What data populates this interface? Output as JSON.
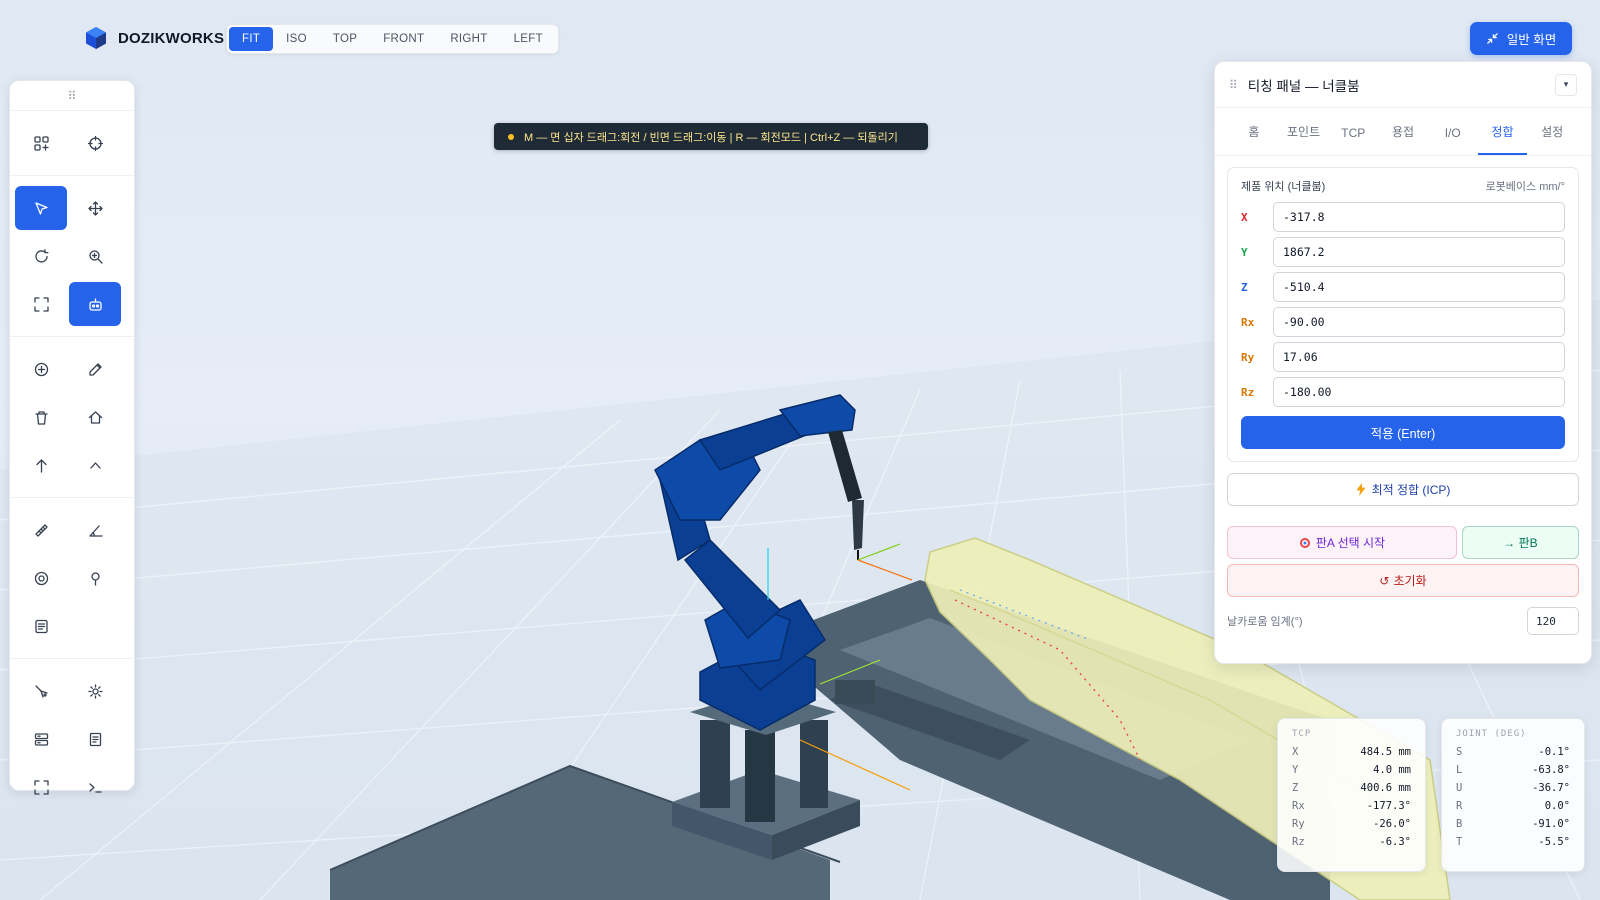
{
  "app": {
    "brand": "DOZIKWORKS"
  },
  "view_tabs": [
    "FIT",
    "ISO",
    "TOP",
    "FRONT",
    "RIGHT",
    "LEFT"
  ],
  "active_view": "FIT",
  "normal_view_label": "일반 화면",
  "hint": "M — 면 십자 드래그:회전 / 빈면 드래그:이동 | R — 회전모드 | Ctrl+Z — 되돌리기",
  "toolbar": {
    "groups": [
      [
        "grid-add-icon",
        "crosshair-icon"
      ],
      [
        "cursor-icon",
        "move-icon",
        "rotate-icon",
        "zoom-icon",
        "fullscreen-icon",
        "robot-icon"
      ],
      [
        "add-circle-icon",
        "edit-icon",
        "trash-icon",
        "home-icon",
        "arrow-up-icon",
        "chevron-up-icon"
      ],
      [
        "ruler-icon",
        "angle-icon",
        "target-icon",
        "pin-icon",
        "list-icon"
      ],
      [
        "tool-icon",
        "settings-icon",
        "storage-icon",
        "document-icon",
        "expand-icon",
        "terminal-icon"
      ]
    ],
    "active": [
      "cursor-icon",
      "robot-icon"
    ]
  },
  "panel": {
    "title": "티칭 패널 — 너클붐",
    "tabs": [
      "홈",
      "포인트",
      "TCP",
      "용접",
      "I/O",
      "정합",
      "설정"
    ],
    "active_tab": "정합",
    "position_card": {
      "title": "제품 위치 (너클붐)",
      "subtitle": "로봇베이스 mm/°",
      "fields": [
        {
          "label": "X",
          "value": "-317.8",
          "color": "#dc2626"
        },
        {
          "label": "Y",
          "value": "1867.2",
          "color": "#16a34a"
        },
        {
          "label": "Z",
          "value": "-510.4",
          "color": "#2563eb"
        },
        {
          "label": "Rx",
          "value": "-90.00",
          "color": "#d97706"
        },
        {
          "label": "Ry",
          "value": "17.06",
          "color": "#d97706"
        },
        {
          "label": "Rz",
          "value": "-180.00",
          "color": "#d97706"
        }
      ],
      "apply_label": "적용 (Enter)"
    },
    "icp_label": "최적 정합 (ICP)",
    "plate_a_label": "판A 선택 시작",
    "plate_b_label": "→ 판B",
    "reset_label": "초기화",
    "threshold_label": "날카로움 임계(°)",
    "threshold_value": "120"
  },
  "tcp": {
    "title": "TCP",
    "rows": [
      {
        "k": "X",
        "v": "484.5 mm"
      },
      {
        "k": "Y",
        "v": "4.0 mm"
      },
      {
        "k": "Z",
        "v": "400.6 mm"
      },
      {
        "k": "Rx",
        "v": "-177.3°"
      },
      {
        "k": "Ry",
        "v": "-26.0°"
      },
      {
        "k": "Rz",
        "v": "-6.3°"
      }
    ]
  },
  "joint": {
    "title": "JOINT (DEG)",
    "rows": [
      {
        "k": "S",
        "v": "-0.1°"
      },
      {
        "k": "L",
        "v": "-63.8°"
      },
      {
        "k": "U",
        "v": "-36.7°"
      },
      {
        "k": "R",
        "v": "0.0°"
      },
      {
        "k": "B",
        "v": "-91.0°"
      },
      {
        "k": "T",
        "v": "-5.5°"
      }
    ]
  },
  "colors": {
    "accent": "#2563eb",
    "robot": "#0b3f94",
    "workpiece": "#eef0b8"
  }
}
